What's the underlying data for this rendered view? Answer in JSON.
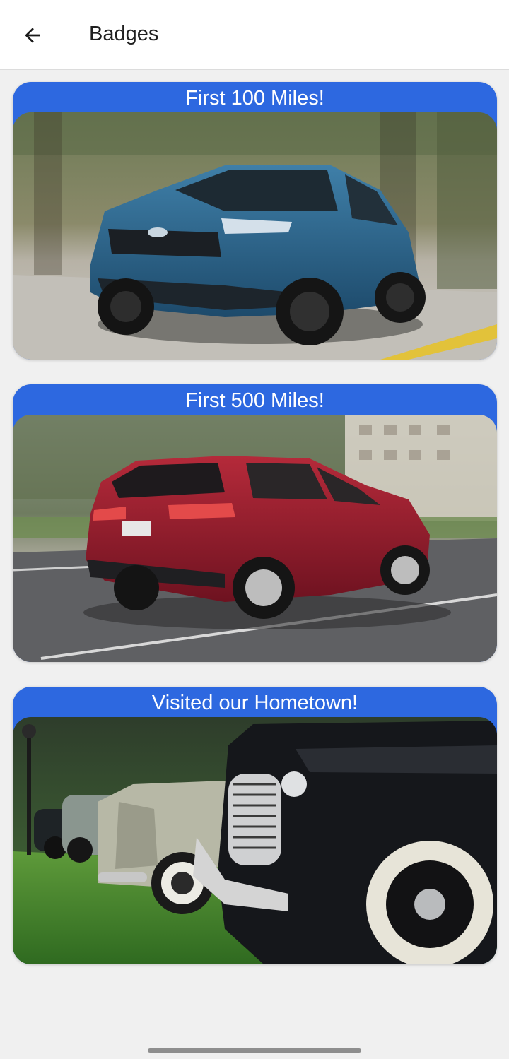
{
  "header": {
    "title": "Badges",
    "back_icon": "arrow-left-icon"
  },
  "badges": [
    {
      "title": "First 100 Miles!",
      "image": "blue-suv-driving-photo"
    },
    {
      "title": "First 500 Miles!",
      "image": "red-suv-driving-photo"
    },
    {
      "title": "Visited our Hometown!",
      "image": "vintage-cars-on-lawn-photo"
    }
  ],
  "colors": {
    "card_header": "#2d68e0",
    "background": "#f0f0f0",
    "app_bar": "#ffffff"
  }
}
